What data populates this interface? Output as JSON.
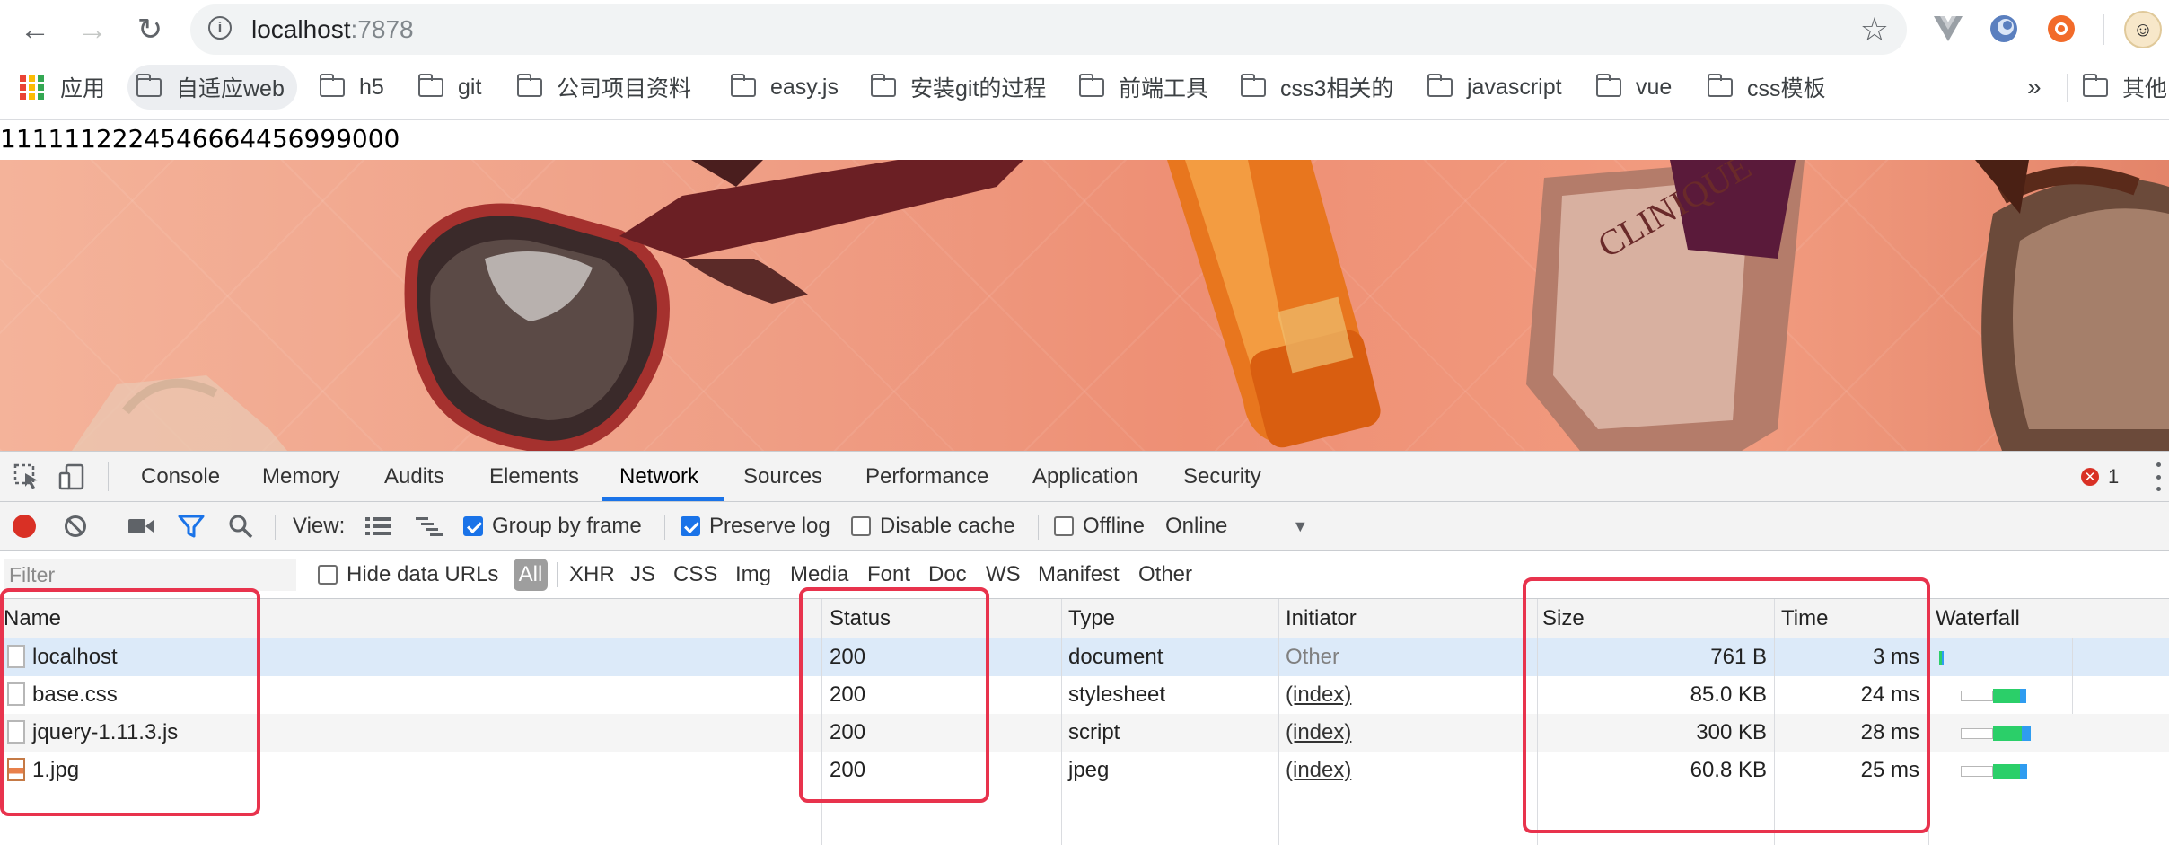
{
  "browser": {
    "url_host": "localhost",
    "url_port": ":7878",
    "bookmarks": [
      {
        "label": "应用"
      },
      {
        "label": "自适应web"
      },
      {
        "label": "h5"
      },
      {
        "label": "git"
      },
      {
        "label": "公司项目资料"
      },
      {
        "label": "easy.js"
      },
      {
        "label": "安装git的过程"
      },
      {
        "label": "前端工具"
      },
      {
        "label": "css3相关的"
      },
      {
        "label": "javascript"
      },
      {
        "label": "vue"
      },
      {
        "label": "css模板"
      }
    ],
    "more": "»",
    "other_bookmarks": "其他"
  },
  "page": {
    "text": "11111122245466644569990​00"
  },
  "devtools": {
    "tabs": [
      "Console",
      "Memory",
      "Audits",
      "Elements",
      "Network",
      "Sources",
      "Performance",
      "Application",
      "Security"
    ],
    "active_tab": "Network",
    "error_count": "1",
    "toolbar": {
      "view_label": "View:",
      "group_by_frame": "Group by frame",
      "preserve_log": "Preserve log",
      "disable_cache": "Disable cache",
      "offline": "Offline",
      "throttling": "Online"
    },
    "filter": {
      "placeholder": "Filter",
      "hide_data_urls": "Hide data URLs",
      "types": [
        "All",
        "XHR",
        "JS",
        "CSS",
        "Img",
        "Media",
        "Font",
        "Doc",
        "WS",
        "Manifest",
        "Other"
      ]
    },
    "columns": [
      "Name",
      "Status",
      "Type",
      "Initiator",
      "Size",
      "Time",
      "Waterfall"
    ],
    "rows": [
      {
        "name": "localhost",
        "status": "200",
        "type": "document",
        "initiator": "Other",
        "size": "761 B",
        "time": "3 ms"
      },
      {
        "name": "base.css",
        "status": "200",
        "type": "stylesheet",
        "initiator": "(index)",
        "size": "85.0 KB",
        "time": "24 ms"
      },
      {
        "name": "jquery-1.11.3.js",
        "status": "200",
        "type": "script",
        "initiator": "(index)",
        "size": "300 KB",
        "time": "28 ms"
      },
      {
        "name": "1.jpg",
        "status": "200",
        "type": "jpeg",
        "initiator": "(index)",
        "size": "60.8 KB",
        "time": "25 ms"
      }
    ]
  },
  "colors": {
    "accent": "#1a73e8",
    "highlight": "#e8334d",
    "record": "#d93025",
    "waterfall_green": "#2bcf69",
    "waterfall_blue": "#2f9cf0"
  }
}
